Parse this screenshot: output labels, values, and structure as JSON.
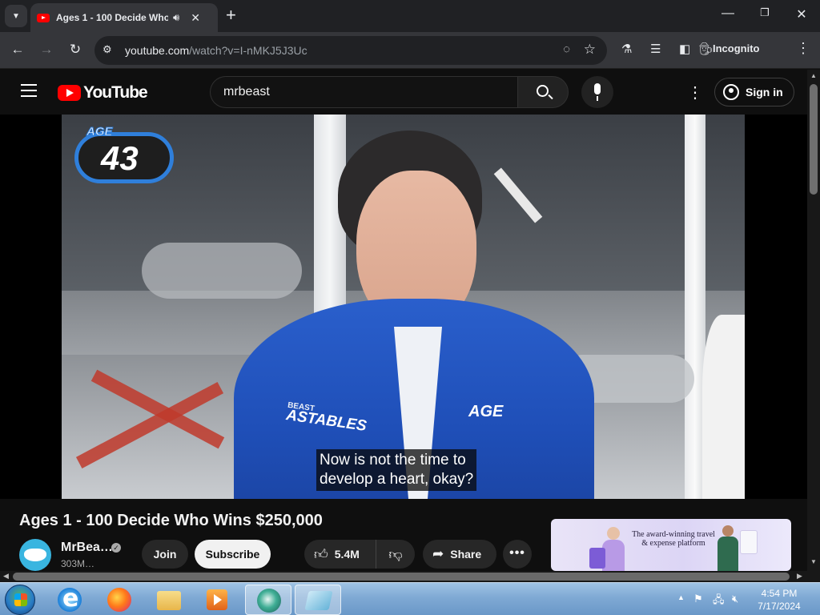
{
  "browser": {
    "tab_title": "Ages 1 - 100 Decide Who Wins $250,000",
    "url_host": "youtube.com",
    "url_path": "/watch?v=I-nMKJ5J3Uc",
    "profile_label": "Incognito"
  },
  "youtube": {
    "logo_text": "YouTube",
    "search_value": "mrbeast",
    "sign_in_label": "Sign in"
  },
  "video": {
    "badge_label": "AGE",
    "badge_number": "43",
    "caption_line1": "Now is not the time to",
    "caption_line2": "develop a heart, okay?",
    "jacket_text": "BEAST",
    "jacket_logo": "ASTABLES",
    "jacket_age": "AGE",
    "title": "Ages 1 - 100 Decide Who Wins $250,000"
  },
  "channel": {
    "name": "MrBea…",
    "subscribers": "303M…",
    "join_label": "Join",
    "subscribe_label": "Subscribe"
  },
  "actions": {
    "like_count": "5.4M",
    "share_label": "Share",
    "more_label": "•••"
  },
  "ad": {
    "text": "The award-winning travel & expense platform"
  },
  "taskbar": {
    "time": "4:54 PM",
    "date": "7/17/2024"
  },
  "colors": {
    "yt_red": "#ff0000",
    "page_bg": "#0f0f0f",
    "chip_bg": "#272727",
    "badge_blue": "#2f7fdb",
    "jacket_blue": "#1f4fb8"
  }
}
